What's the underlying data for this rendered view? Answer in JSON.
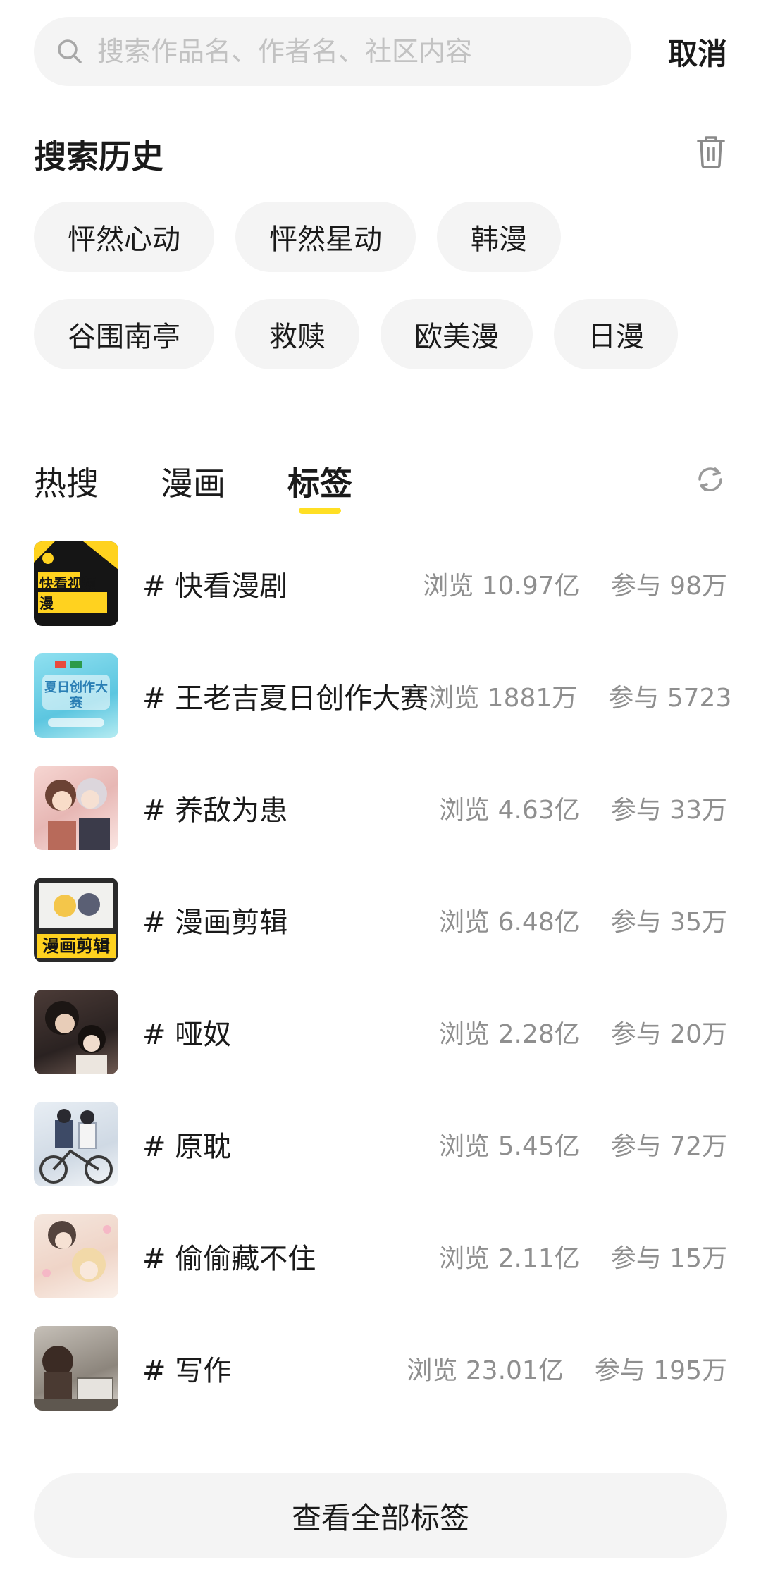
{
  "search": {
    "placeholder": "搜索作品名、作者名、社区内容",
    "cancel_label": "取消"
  },
  "history": {
    "title": "搜索历史",
    "items": [
      "怦然心动",
      "怦然星动",
      "韩漫",
      "谷围南亭",
      "救赎",
      "欧美漫",
      "日漫"
    ]
  },
  "tabs": [
    {
      "label": "热搜",
      "active": false
    },
    {
      "label": "漫画",
      "active": false
    },
    {
      "label": "标签",
      "active": true
    }
  ],
  "accent_color": "#ffdf24",
  "tags": [
    {
      "name": "# 快看漫剧",
      "views": "浏览 10.97亿",
      "participants": "参与 98万",
      "thumb_text": "快看视频漫"
    },
    {
      "name": "# 王老吉夏日创作大赛",
      "views": "浏览 1881万",
      "participants": "参与 5723",
      "thumb_text": "夏日创作大赛"
    },
    {
      "name": "# 养敌为患",
      "views": "浏览 4.63亿",
      "participants": "参与 33万"
    },
    {
      "name": "# 漫画剪辑",
      "views": "浏览 6.48亿",
      "participants": "参与 35万",
      "thumb_text": "漫画剪辑"
    },
    {
      "name": "# 哑奴",
      "views": "浏览 2.28亿",
      "participants": "参与 20万"
    },
    {
      "name": "# 原耽",
      "views": "浏览 5.45亿",
      "participants": "参与 72万"
    },
    {
      "name": "# 偷偷藏不住",
      "views": "浏览 2.11亿",
      "participants": "参与 15万"
    },
    {
      "name": "# 写作",
      "views": "浏览 23.01亿",
      "participants": "参与 195万"
    }
  ],
  "view_all_label": "查看全部标签"
}
